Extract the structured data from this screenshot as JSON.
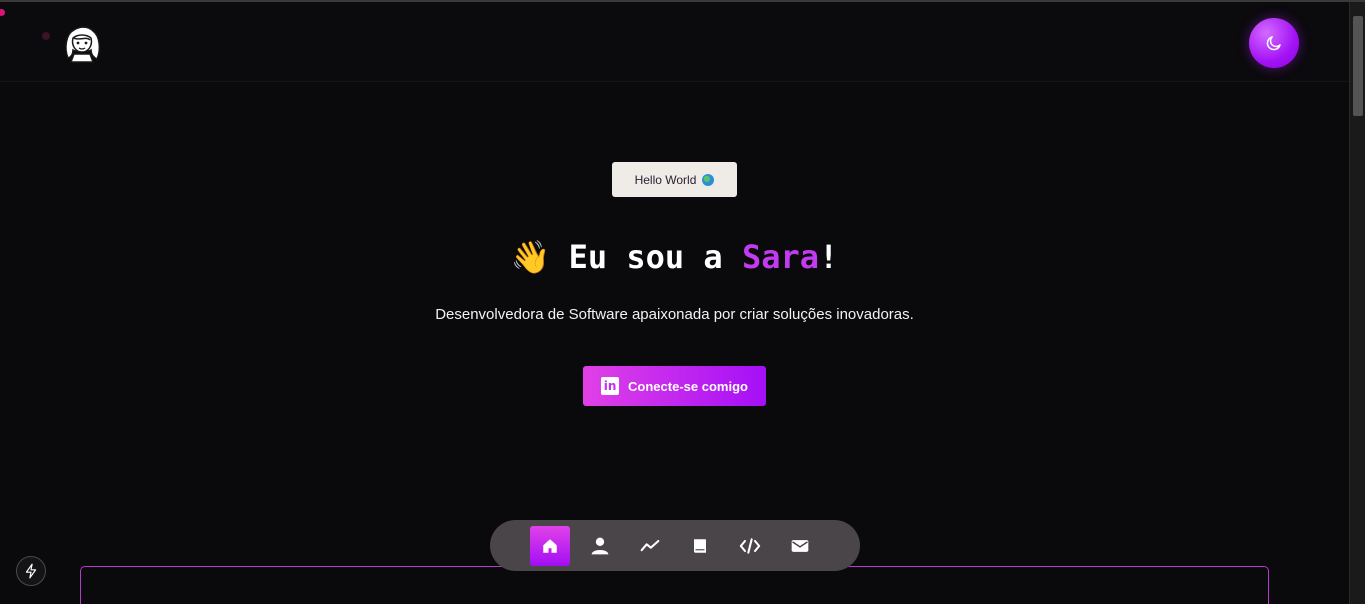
{
  "header": {
    "logo_icon": "girl-avatar-icon",
    "theme_toggle_icon": "moon-icon"
  },
  "hero": {
    "badge_text": "Hello World",
    "badge_icon": "globe-icon",
    "title_wave": "👋",
    "title_prefix": "Eu sou a ",
    "title_name": "Sara",
    "title_suffix": "!",
    "subtitle": "Desenvolvedora de Software apaixonada por criar soluções inovadoras.",
    "cta_icon": "linkedin-icon",
    "cta_label": "Conecte-se comigo"
  },
  "nav": {
    "items": [
      {
        "icon": "home-icon",
        "active": true
      },
      {
        "icon": "user-icon",
        "active": false
      },
      {
        "icon": "chart-icon",
        "active": false
      },
      {
        "icon": "book-icon",
        "active": false
      },
      {
        "icon": "code-icon",
        "active": false
      },
      {
        "icon": "mail-icon",
        "active": false
      }
    ]
  },
  "colors": {
    "background": "#09080b",
    "accent": "#a50ff7",
    "accent_pink": "#e041e6",
    "name_highlight": "#c23bf0",
    "nav_background": "#4a4548"
  },
  "floating": {
    "bolt_icon": "lightning-icon"
  }
}
